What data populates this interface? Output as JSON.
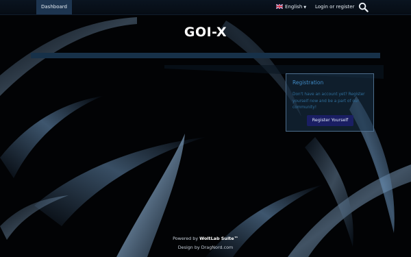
{
  "topbar": {
    "dashboard_label": "Dashboard",
    "language_label": "English",
    "language_flag": "uk-flag-icon",
    "login_label": "Login or register",
    "search_icon": "search-icon"
  },
  "logo": {
    "text": "GOI-X"
  },
  "sidebar": {
    "registration": {
      "title": "Registration",
      "text": "Don't have an account yet? Register yourself now and be a part of our community!",
      "button_label": "Register Yourself"
    }
  },
  "footer": {
    "powered_prefix": "Powered by",
    "powered_brand": "WoltLab Suite™",
    "design_prefix": "Design by",
    "design_link": "DragNord.com"
  },
  "colors": {
    "accent": "#1d3550",
    "button": "#1a1e63",
    "box_title": "#3f89c4"
  }
}
